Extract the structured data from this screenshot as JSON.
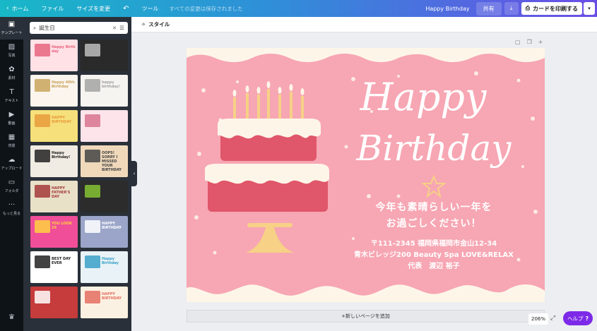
{
  "topbar": {
    "home": "ホーム",
    "file": "ファイル",
    "resize": "サイズを変更",
    "undo_icon": "undo-icon",
    "tools": "ツール",
    "saved_status": "すべての変更は保存されました",
    "doc_title": "Happy Birthday",
    "share": "共有",
    "print": "カードを印刷する"
  },
  "nav": [
    {
      "label": "テンプレート",
      "icon": "template-icon"
    },
    {
      "label": "写真",
      "icon": "photo-icon"
    },
    {
      "label": "素材",
      "icon": "elements-icon"
    },
    {
      "label": "テキスト",
      "icon": "text-icon"
    },
    {
      "label": "動画",
      "icon": "video-icon"
    },
    {
      "label": "背景",
      "icon": "background-icon"
    },
    {
      "label": "アップロード",
      "icon": "upload-icon"
    },
    {
      "label": "フォルダ",
      "icon": "folder-icon"
    },
    {
      "label": "もっと見る",
      "icon": "more-icon"
    }
  ],
  "search": {
    "value": "誕生日"
  },
  "toolbar": {
    "style": "スタイル"
  },
  "thumbs": [
    {
      "bg": "#ffe1e6",
      "accent": "#e8647e",
      "text": "Happy Birth day"
    },
    {
      "bg": "#2a2a2a",
      "accent": "#bdbdbd",
      "text": ""
    },
    {
      "bg": "#fbf5ee",
      "accent": "#c9a45c",
      "text": "Happy 40th Birthday"
    },
    {
      "bg": "#f6f4f0",
      "accent": "#a3a3a3",
      "text": "happy birthday!"
    },
    {
      "bg": "#f6e07b",
      "accent": "#e89a3c",
      "text": "HAPPY BIRTHDAY"
    },
    {
      "bg": "#fce4ea",
      "accent": "#d8738e",
      "text": ""
    },
    {
      "bg": "#f1ece3",
      "accent": "#222222",
      "text": "Happy Birthday!"
    },
    {
      "bg": "#f0d9bb",
      "accent": "#444444",
      "text": "OOPS! SORRY I MISSED YOUR BIRTHDAY"
    },
    {
      "bg": "#e9e0c8",
      "accent": "#a33a3a",
      "text": "HAPPY FATHER'S DAY"
    },
    {
      "bg": "#2c2c2c",
      "accent": "#86c232",
      "text": ""
    },
    {
      "bg": "#f04e98",
      "accent": "#ffd23f",
      "text": "YOU LOOK 29"
    },
    {
      "bg": "#9aa5c9",
      "accent": "#ffffff",
      "text": "HAPPY BIRTHDAY"
    },
    {
      "bg": "#ffffff",
      "accent": "#222222",
      "text": "BEST DAY EVER"
    },
    {
      "bg": "#e9f3f7",
      "accent": "#3aa0c8",
      "text": "Happy Birthday"
    },
    {
      "bg": "#c63b3b",
      "accent": "#ffffff",
      "text": ""
    },
    {
      "bg": "#fbf1e2",
      "accent": "#e46f61",
      "text": "HAPPY BIRTHDAY"
    }
  ],
  "card": {
    "title_1": "Happy",
    "title_2": "Birthday",
    "msg_line1": "今年も素晴らしい一年を",
    "msg_line2": "お過ごしください！",
    "addr_line1": "〒111-2345 福岡県福岡市金山12-34",
    "addr_line2": "青木ビレッジ200 Beauty Spa LOVE&RELAX",
    "addr_line3": "代表　渡辺 裕子",
    "colors": {
      "bg": "#f7a6b3",
      "cake_red": "#e0566a",
      "cream": "#fdf6e8",
      "candle": "#f6d186"
    }
  },
  "footer": {
    "add_page": "+新しいページを追加",
    "zoom": "206%",
    "help": "ヘルプ"
  }
}
